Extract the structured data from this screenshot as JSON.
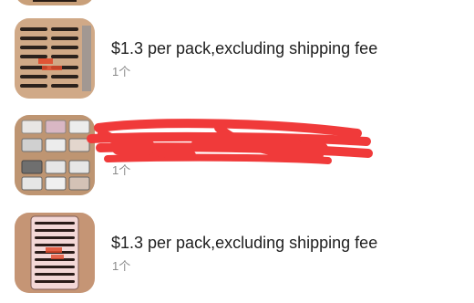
{
  "items": [
    {
      "title": "",
      "qty": ""
    },
    {
      "title": "$1.3 per pack,excluding shipping fee",
      "qty": "1个"
    },
    {
      "title": "",
      "qty": "1个"
    },
    {
      "title": "$1.3 per pack,excluding shipping fee",
      "qty": "1个"
    }
  ],
  "colors": {
    "redaction": "#f03a3a",
    "title": "#1f1f1f",
    "qty": "#8a8a8a"
  },
  "icons": [
    "product-thumbnail",
    "redaction-scribble"
  ]
}
